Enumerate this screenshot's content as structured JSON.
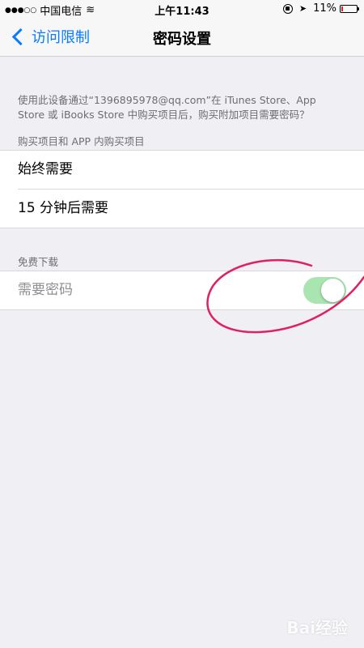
{
  "status_bar": {
    "signal": "●●●○○",
    "carrier": "中国电信",
    "wifi": "≋",
    "time": "上午11:43",
    "location": "➤",
    "battery_percent": "11%",
    "battery_level": 0.11
  },
  "nav": {
    "back_label": "访问限制",
    "title": "密码设置"
  },
  "description": "使用此设备通过“1396895978@qq.com”在 iTunes Store、App Store 或 iBooks Store 中购买项目后，购买附加项目需要密码？",
  "sections": [
    {
      "header": "购买项目和 APP 内购买项目",
      "items": [
        "始终需要",
        "15 分钟后需要"
      ]
    },
    {
      "header": "免费下载",
      "items": [
        "需要密码"
      ],
      "toggle_on": true
    }
  ],
  "colors": {
    "accent": "#0a7aff",
    "toggle_on": "#a8e5b0",
    "annotation": "#e0205f"
  },
  "watermark": "Bai经验"
}
